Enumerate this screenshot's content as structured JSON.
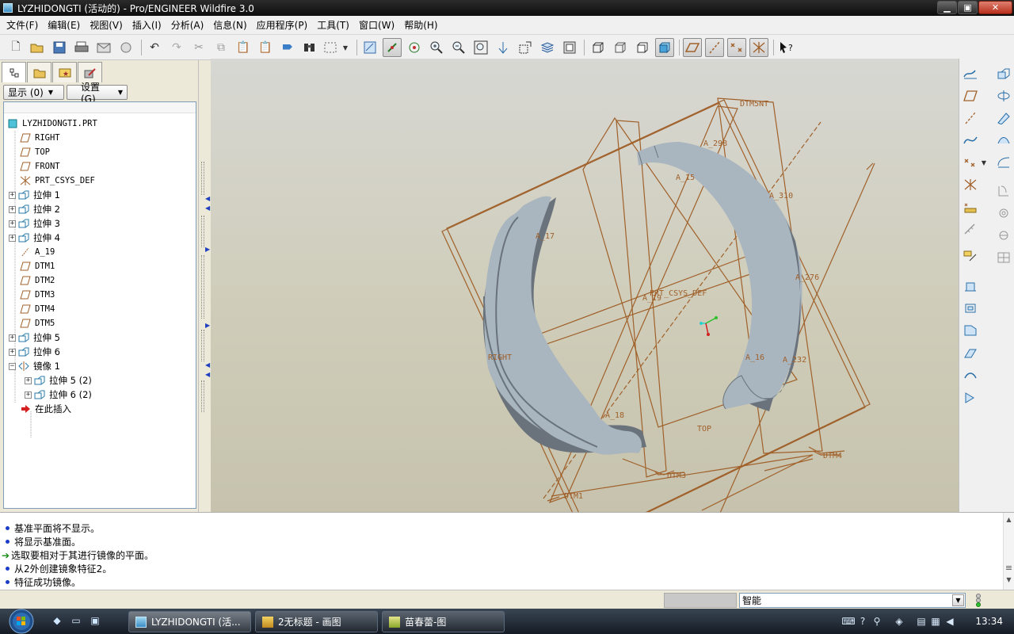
{
  "window": {
    "title": "LYZHIDONGTI (活动的) - Pro/ENGINEER Wildfire 3.0",
    "controls": [
      "minimize-icon",
      "maximize-icon",
      "close-icon"
    ]
  },
  "menu": [
    "文件(F)",
    "编辑(E)",
    "视图(V)",
    "插入(I)",
    "分析(A)",
    "信息(N)",
    "应用程序(P)",
    "工具(T)",
    "窗口(W)",
    "帮助(H)"
  ],
  "navigator": {
    "tabs": [
      "model-tree-tab",
      "layer-tab",
      "favorites-tab",
      "connections-tab"
    ],
    "show_button": "显示 (0)",
    "settings_button": "设置 (G)",
    "tree": [
      {
        "label": "LYZHIDONGTI.PRT",
        "icon": "part-icon",
        "expand": ""
      },
      {
        "label": "RIGHT",
        "icon": "datum-plane-icon",
        "expand": ""
      },
      {
        "label": "TOP",
        "icon": "datum-plane-icon",
        "expand": ""
      },
      {
        "label": "FRONT",
        "icon": "datum-plane-icon",
        "expand": ""
      },
      {
        "label": "PRT_CSYS_DEF",
        "icon": "coord-sys-icon",
        "expand": ""
      },
      {
        "label": "拉伸 1",
        "icon": "extrude-icon",
        "expand": "+"
      },
      {
        "label": "拉伸 2",
        "icon": "extrude-icon",
        "expand": "+"
      },
      {
        "label": "拉伸 3",
        "icon": "extrude-icon",
        "expand": "+"
      },
      {
        "label": "拉伸 4",
        "icon": "extrude-icon",
        "expand": "+"
      },
      {
        "label": "A_19",
        "icon": "datum-axis-icon",
        "expand": ""
      },
      {
        "label": "DTM1",
        "icon": "datum-plane-icon",
        "expand": ""
      },
      {
        "label": "DTM2",
        "icon": "datum-plane-icon",
        "expand": ""
      },
      {
        "label": "DTM3",
        "icon": "datum-plane-icon",
        "expand": ""
      },
      {
        "label": "DTM4",
        "icon": "datum-plane-icon",
        "expand": ""
      },
      {
        "label": "DTM5",
        "icon": "datum-plane-icon",
        "expand": ""
      },
      {
        "label": "拉伸 5",
        "icon": "extrude-icon",
        "expand": "+"
      },
      {
        "label": "拉伸 6",
        "icon": "extrude-icon",
        "expand": "+"
      },
      {
        "label": "镜像 1",
        "icon": "mirror-icon",
        "expand": "-"
      },
      {
        "label": "拉伸 5 (2)",
        "icon": "extrude-icon",
        "expand": "+"
      },
      {
        "label": "拉伸 6 (2)",
        "icon": "extrude-icon",
        "expand": "+"
      },
      {
        "label": "在此插入",
        "icon": "insert-here-icon",
        "expand": ""
      }
    ]
  },
  "viewport": {
    "labels": [
      "DTM5NT",
      "A_298",
      "A_15",
      "A_310",
      "A_17",
      "A_276",
      "PRT_CSYS_DEF",
      "A_19",
      "RIGHT",
      "A_16",
      "A_232",
      "A_18",
      "TOP",
      "DTM4",
      "DTM3",
      "DTM1"
    ],
    "colors": {
      "datum": "#a0602a",
      "part": "#a9b5bf",
      "part_edge": "#6a737b"
    }
  },
  "messages": [
    {
      "type": "info",
      "text": "基准平面将不显示。"
    },
    {
      "type": "info",
      "text": "将显示基准面。"
    },
    {
      "type": "prompt",
      "text": "选取要相对于其进行镜像的平面。"
    },
    {
      "type": "info",
      "text": "从2外创建镜象特征2。"
    },
    {
      "type": "info",
      "text": "特征成功镜像。"
    }
  ],
  "status": {
    "filter": "智能"
  },
  "taskbar": {
    "tasks": [
      "LYZHIDONGTI (活...",
      "2无标题 - 画图",
      "苗春蕾-图"
    ],
    "clock": "13:34"
  }
}
